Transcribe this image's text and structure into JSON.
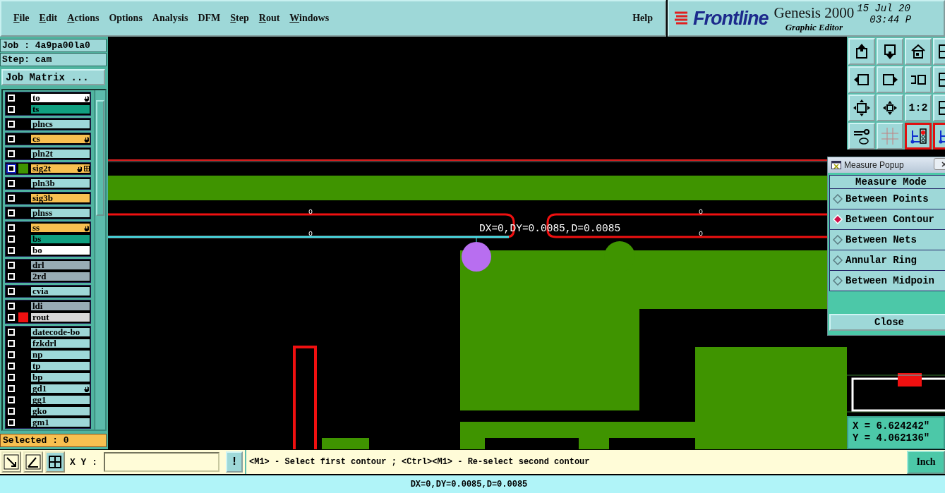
{
  "menu": [
    {
      "label": "File",
      "underlined": true
    },
    {
      "label": "Edit",
      "underlined": true
    },
    {
      "label": "Actions",
      "underlined": true
    },
    {
      "label": "Options",
      "underlined": false
    },
    {
      "label": "Analysis",
      "underlined": false
    },
    {
      "label": "DFM",
      "underlined": false
    },
    {
      "label": "Step",
      "underlined": true
    },
    {
      "label": "Rout",
      "underlined": true
    },
    {
      "label": "Windows",
      "underlined": true
    },
    {
      "label": "Help",
      "underlined": false
    }
  ],
  "brand": {
    "logo": "Frontline",
    "product": "Genesis 2000",
    "subtitle": "Graphic Editor",
    "date": "15 Jul 20",
    "time": "03:44 P"
  },
  "job_panel": {
    "job": "Job : 4a9pa00la0",
    "step": "Step: cam",
    "matrix_button": "Job Matrix ...",
    "layer_groups": [
      {
        "layers": [
          {
            "name": "to",
            "kind": "silk",
            "work_layer": false,
            "hand_mark": true,
            "grid_mark": false
          },
          {
            "name": "ts",
            "kind": "mask",
            "work_layer": false,
            "hand_mark": false,
            "grid_mark": false
          }
        ]
      },
      {
        "layers": [
          {
            "name": "plncs",
            "kind": "plane",
            "work_layer": false,
            "hand_mark": false,
            "grid_mark": false
          }
        ]
      },
      {
        "layers": [
          {
            "name": "cs",
            "kind": "signal",
            "work_layer": false,
            "hand_mark": true,
            "grid_mark": false
          }
        ]
      },
      {
        "layers": [
          {
            "name": "pln2t",
            "kind": "plane",
            "work_layer": false,
            "hand_mark": false,
            "grid_mark": false
          }
        ]
      },
      {
        "layers": [
          {
            "name": "sig2t",
            "kind": "signal",
            "color": "#3f9400",
            "work_layer": true,
            "hand_mark": true,
            "grid_mark": true
          }
        ]
      },
      {
        "layers": [
          {
            "name": "pln3b",
            "kind": "plane",
            "work_layer": false,
            "hand_mark": false,
            "grid_mark": false
          }
        ]
      },
      {
        "layers": [
          {
            "name": "sig3b",
            "kind": "signal",
            "work_layer": false,
            "hand_mark": false,
            "grid_mark": false
          }
        ]
      },
      {
        "layers": [
          {
            "name": "plnss",
            "kind": "plane",
            "work_layer": false,
            "hand_mark": false,
            "grid_mark": false
          }
        ]
      },
      {
        "layers": [
          {
            "name": "ss",
            "kind": "signal",
            "work_layer": false,
            "hand_mark": true,
            "grid_mark": false
          },
          {
            "name": "bs",
            "kind": "mask",
            "work_layer": false,
            "hand_mark": false,
            "grid_mark": false
          },
          {
            "name": "bo",
            "kind": "silk",
            "work_layer": false,
            "hand_mark": false,
            "grid_mark": false
          }
        ]
      },
      {
        "layers": [
          {
            "name": "drl",
            "kind": "drill",
            "work_layer": false,
            "hand_mark": false,
            "grid_mark": false
          },
          {
            "name": "2rd",
            "kind": "drill",
            "work_layer": false,
            "hand_mark": false,
            "grid_mark": false
          }
        ]
      },
      {
        "layers": [
          {
            "name": "cvia",
            "kind": "plane",
            "work_layer": false,
            "hand_mark": false,
            "grid_mark": false
          }
        ]
      },
      {
        "layers": [
          {
            "name": "ldi",
            "kind": "drill",
            "work_layer": false,
            "hand_mark": false,
            "grid_mark": false
          },
          {
            "name": "rout",
            "kind": "rout",
            "color": "#f01010",
            "work_layer": false,
            "hand_mark": false,
            "grid_mark": false
          }
        ]
      },
      {
        "layers": [
          {
            "name": "datecode-bo",
            "kind": "plane",
            "work_layer": false,
            "hand_mark": false,
            "grid_mark": false
          },
          {
            "name": "fzkdrl",
            "kind": "plane",
            "work_layer": false,
            "hand_mark": false,
            "grid_mark": false
          },
          {
            "name": "np",
            "kind": "plane",
            "work_layer": false,
            "hand_mark": false,
            "grid_mark": false
          },
          {
            "name": "tp",
            "kind": "plane",
            "work_layer": false,
            "hand_mark": false,
            "grid_mark": false
          },
          {
            "name": "bp",
            "kind": "plane",
            "work_layer": false,
            "hand_mark": false,
            "grid_mark": false
          },
          {
            "name": "gd1",
            "kind": "plane",
            "work_layer": false,
            "hand_mark": true,
            "grid_mark": false
          },
          {
            "name": "gg1",
            "kind": "plane",
            "work_layer": false,
            "hand_mark": false,
            "grid_mark": false
          },
          {
            "name": "gko",
            "kind": "plane",
            "work_layer": false,
            "hand_mark": false,
            "grid_mark": false
          },
          {
            "name": "gm1",
            "kind": "plane",
            "work_layer": false,
            "hand_mark": false,
            "grid_mark": false
          }
        ]
      }
    ],
    "selected": "Selected : 0"
  },
  "canvas": {
    "measurement": "DX=0,DY=0.0085,D=0.0085"
  },
  "toolbar": [
    {
      "kind": "up",
      "active": false
    },
    {
      "kind": "down",
      "active": false
    },
    {
      "kind": "home",
      "active": false
    },
    {
      "kind": "panel",
      "active": false
    },
    {
      "kind": "left",
      "active": false
    },
    {
      "kind": "right",
      "active": false
    },
    {
      "kind": "undo",
      "active": false
    },
    {
      "kind": "panel",
      "active": false
    },
    {
      "kind": "fit",
      "active": false
    },
    {
      "kind": "center",
      "active": false
    },
    {
      "kind": "ratio",
      "label": "1:2",
      "active": false
    },
    {
      "kind": "panel",
      "active": false
    },
    {
      "kind": "tools",
      "active": false
    },
    {
      "kind": "grid",
      "active": false
    },
    {
      "kind": "net",
      "active": true
    },
    {
      "kind": "net",
      "active": true
    }
  ],
  "measure_popup": {
    "title": "Measure Popup",
    "heading": "Measure Mode",
    "modes": [
      {
        "label": "Between Points",
        "selected": false
      },
      {
        "label": "Between Contour",
        "selected": true
      },
      {
        "label": "Between Nets",
        "selected": false
      },
      {
        "label": "Annular Ring",
        "selected": false
      },
      {
        "label": "Between Midpoin",
        "selected": false
      }
    ],
    "close": "Close"
  },
  "coordinates": {
    "x": "X = 6.624242\"",
    "y": "Y = 4.062136\""
  },
  "command_bar": {
    "xy_label": "X Y :",
    "alert": "!",
    "message": "<M1> - Select first contour ; <Ctrl><M1> - Re-select second contour",
    "unit": "Inch"
  },
  "status_bar": {
    "text": "DX=0,DY=0.0085,D=0.0085"
  }
}
